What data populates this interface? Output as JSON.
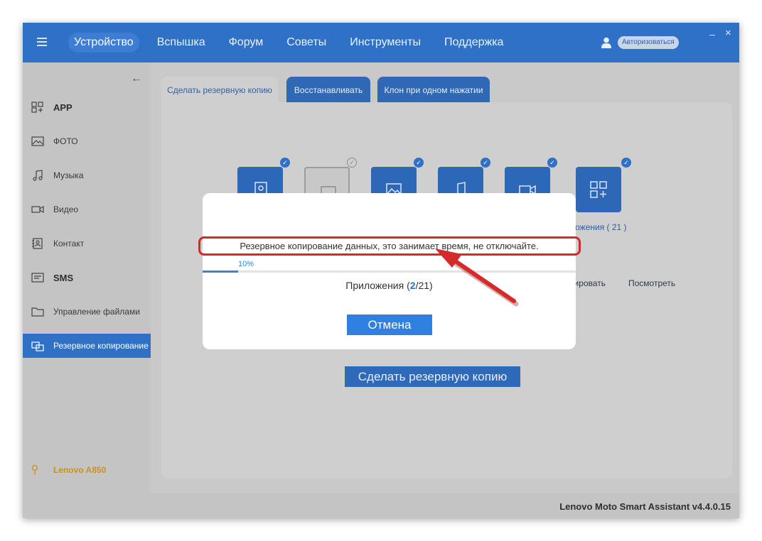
{
  "app": {
    "nav": [
      "Устройство",
      "Вспышка",
      "Форум",
      "Советы",
      "Инструменты",
      "Поддержка"
    ],
    "active_nav_index": 0,
    "login_label": "Авторизоваться",
    "minimize_glyph": "–",
    "close_glyph": "×"
  },
  "sidebar": {
    "items": [
      {
        "label": "APP",
        "icon": "apps-grid-icon"
      },
      {
        "label": "ФОТО",
        "icon": "photo-icon"
      },
      {
        "label": "Музыка",
        "icon": "music-note-icon"
      },
      {
        "label": "Видео",
        "icon": "video-camera-icon"
      },
      {
        "label": "Контакт",
        "icon": "contact-book-icon"
      },
      {
        "label": "SMS",
        "icon": "sms-message-icon"
      },
      {
        "label": "Управление файлами",
        "icon": "folder-icon"
      },
      {
        "label": "Резервное копирование",
        "icon": "backup-icon"
      }
    ],
    "active_index": 7,
    "device": "Lenovo A850"
  },
  "tabs": [
    "Сделать резервную копию",
    "Восстанавливать",
    "Клон при одном нажатии"
  ],
  "background": {
    "apps_label": "ложения ( 21 )",
    "action_left": "тировать",
    "action_view": "Посмотреть",
    "backup_button": "Сделать резервную копию"
  },
  "dialog": {
    "message": "Резервное копирование данных, это занимает время, не отключайте.",
    "progress_percent": 10,
    "progress_label": "10%",
    "status_prefix": "Приложения (",
    "status_current": "2",
    "status_suffix": "/21)",
    "cancel_label": "Отмена"
  },
  "footer": {
    "version": "Lenovo Moto Smart Assistant v4.4.0.15"
  },
  "colors": {
    "accent": "#2f71c7",
    "highlight": "#d42a2a"
  }
}
